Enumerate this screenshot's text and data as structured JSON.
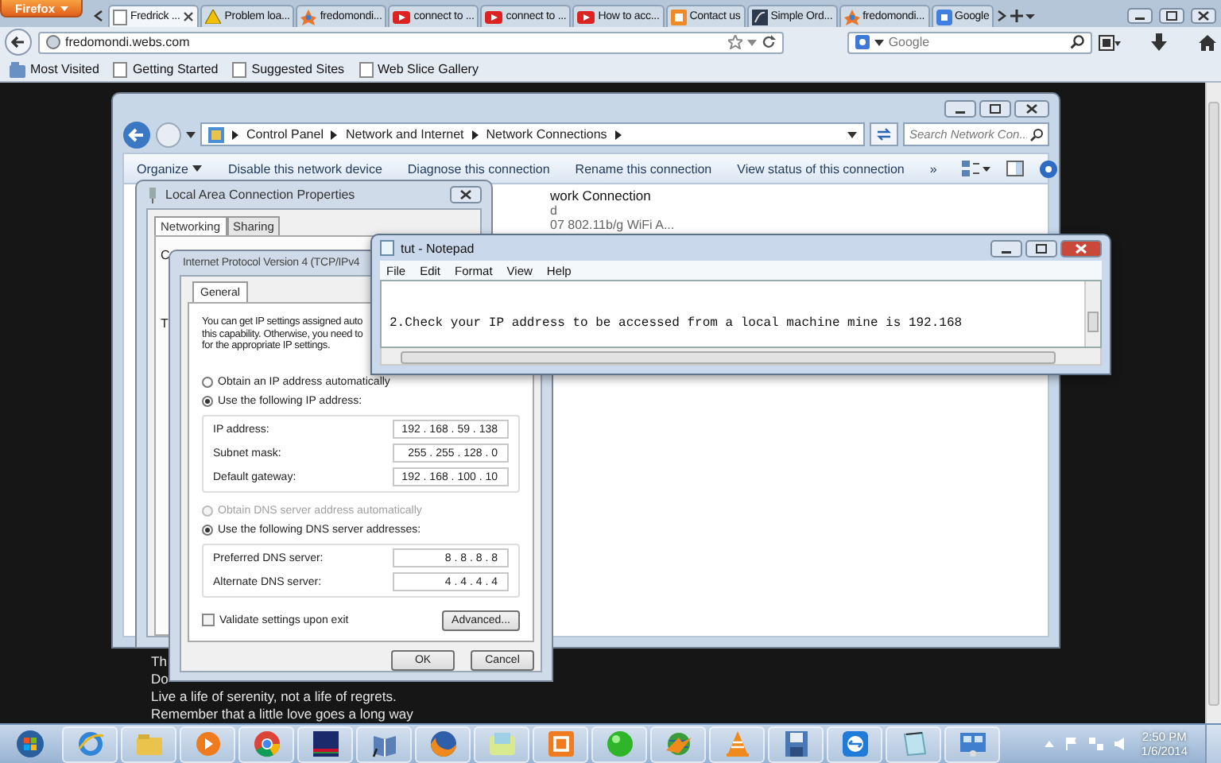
{
  "browser": {
    "menu_button": "Firefox",
    "tabs": [
      {
        "label": "Fredrick ...",
        "selected": true
      },
      {
        "label": "Problem loa...",
        "selected": false
      },
      {
        "label": "fredomondi...",
        "selected": false
      },
      {
        "label": "connect to ...",
        "selected": false
      },
      {
        "label": "connect to ...",
        "selected": false
      },
      {
        "label": "How to acc...",
        "selected": false
      },
      {
        "label": "Contact us",
        "selected": false
      },
      {
        "label": "Simple Ord...",
        "selected": false
      },
      {
        "label": "fredomondi...",
        "selected": false
      },
      {
        "label": "Google",
        "selected": false
      }
    ],
    "address": "fredomondi.webs.com",
    "search": {
      "placeholder": "Google"
    },
    "bookmarks": [
      "Most Visited",
      "Getting Started",
      "Suggested Sites",
      "Web Slice Gallery"
    ]
  },
  "page": {
    "lines": [
      "Th",
      "Do",
      "Live a life of serenity, not a life of regrets.",
      "Remember that a little love goes a long way"
    ]
  },
  "explorer": {
    "breadcrumb": [
      "Control Panel",
      "Network and Internet",
      "Network Connections"
    ],
    "search": {
      "placeholder": "Search Network Con..."
    },
    "toolbar": [
      "Organize",
      "Disable this network device",
      "Diagnose this connection",
      "Rename this connection",
      "View status of this connection"
    ],
    "more": "»",
    "items": [
      "work Connection",
      "d",
      "07 802.11b/g WiFi A..."
    ]
  },
  "lan_properties": {
    "title": "Local Area Connection Properties",
    "tabs": [
      {
        "label": "Networking",
        "selected": true
      },
      {
        "label": "Sharing",
        "selected": false
      }
    ],
    "fragments": [
      "C",
      "T"
    ]
  },
  "ipv4": {
    "title": "Internet Protocol Version 4 (TCP/IPv4",
    "tabs": [
      {
        "label": "General",
        "selected": true
      }
    ],
    "intro": [
      "You can get IP settings assigned auto",
      "this capability. Otherwise, you need to",
      "for the appropriate IP settings."
    ],
    "ip_mode": [
      {
        "label": "Obtain an IP address automatically",
        "selected": false,
        "disabled": false
      },
      {
        "label": "Use the following IP address:",
        "selected": true,
        "disabled": false
      }
    ],
    "ip_fields": [
      {
        "label": "IP address:",
        "value": "192 . 168 . 59 . 138"
      },
      {
        "label": "Subnet mask:",
        "value": "255 . 255 . 128 . 0"
      },
      {
        "label": "Default gateway:",
        "value": "192 . 168 . 100 . 10"
      }
    ],
    "dns_mode": [
      {
        "label": "Obtain DNS server address automatically",
        "selected": false,
        "disabled": true
      },
      {
        "label": "Use the following DNS server addresses:",
        "selected": true,
        "disabled": false
      }
    ],
    "dns_fields": [
      {
        "label": "Preferred DNS server:",
        "value": "8 . 8 . 8 . 8"
      },
      {
        "label": "Alternate DNS server:",
        "value": "4 . 4 . 4 . 4"
      }
    ],
    "validate": {
      "label": "Validate settings upon exit",
      "checked": false
    },
    "advanced": "Advanced...",
    "ok": "OK",
    "cancel": "Cancel"
  },
  "notepad": {
    "title": "tut - Notepad",
    "menu": [
      "File",
      "Edit",
      "Format",
      "View",
      "Help"
    ],
    "text": "2.Check your IP address to be accessed from a local machine mine is 192.168"
  },
  "taskbar": {
    "time": "2:50 PM",
    "date": "1/6/2014"
  }
}
